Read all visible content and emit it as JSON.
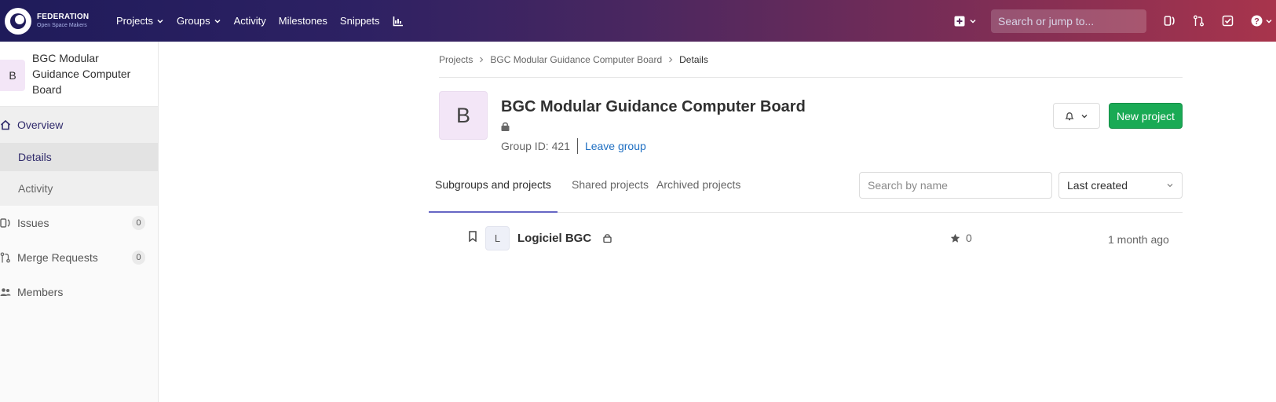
{
  "navbar": {
    "brand_name": "FEDERATION",
    "brand_sub": "Open Space Makers",
    "links": {
      "projects": "Projects",
      "groups": "Groups",
      "activity": "Activity",
      "milestones": "Milestones",
      "snippets": "Snippets"
    },
    "search_placeholder": "Search or jump to..."
  },
  "sidebar": {
    "group_initial": "B",
    "group_name": "BGC Modular Guidance Computer Board",
    "overview": "Overview",
    "details": "Details",
    "activity": "Activity",
    "issues": "Issues",
    "issues_count": "0",
    "merge_requests": "Merge Requests",
    "merge_requests_count": "0",
    "members": "Members"
  },
  "breadcrumb": {
    "projects": "Projects",
    "group": "BGC Modular Guidance Computer Board",
    "current": "Details"
  },
  "group": {
    "initial": "B",
    "title": "BGC Modular Guidance Computer Board",
    "group_id": "Group ID: 421",
    "leave_group": "Leave group",
    "new_project": "New project"
  },
  "tabs": {
    "subgroups": "Subgroups and projects",
    "shared": "Shared projects",
    "archived": "Archived projects",
    "search_placeholder": "Search by name",
    "sort": "Last created"
  },
  "projects": [
    {
      "initial": "L",
      "name": "Logiciel BGC",
      "stars": "0",
      "updated": "1 month ago"
    }
  ],
  "colors": {
    "accent_green": "#1aaa55",
    "link_blue": "#1f6fc2",
    "nav_start": "#1f1b5a",
    "nav_end": "#a8344c"
  }
}
